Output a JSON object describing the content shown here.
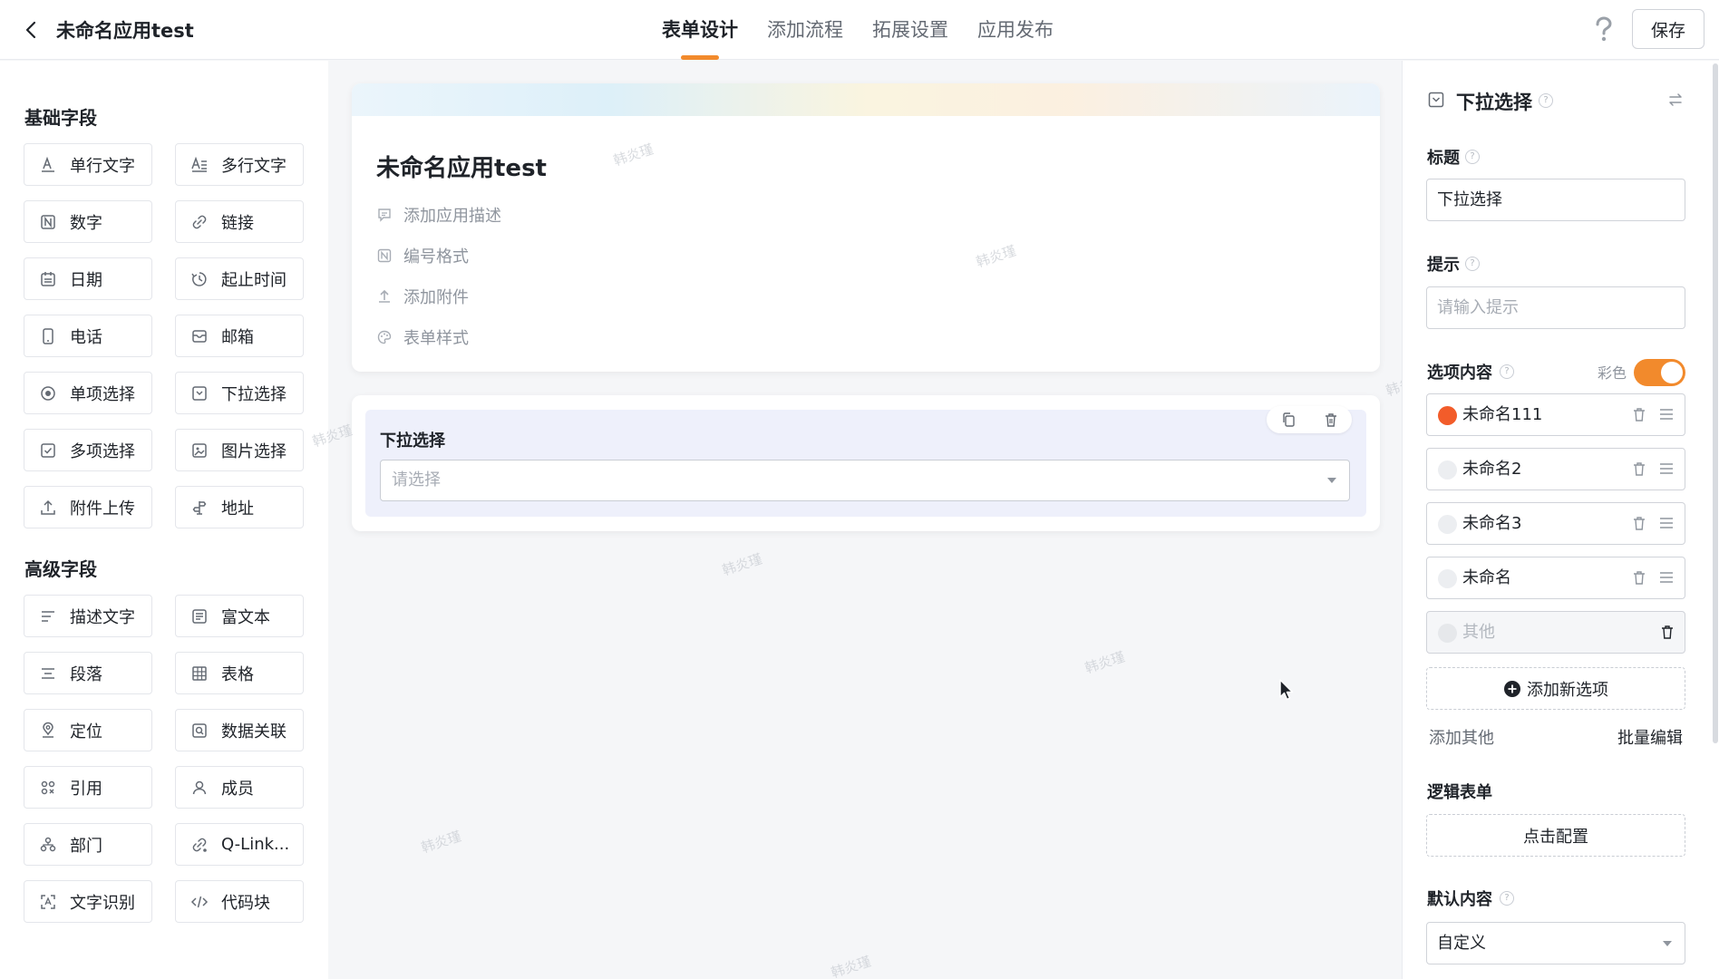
{
  "header": {
    "title": "未命名应用test",
    "tabs": [
      {
        "label": "表单设计",
        "active": true
      },
      {
        "label": "添加流程",
        "active": false
      },
      {
        "label": "拓展设置",
        "active": false
      },
      {
        "label": "应用发布",
        "active": false
      }
    ],
    "save_label": "保存"
  },
  "palette": {
    "basic_title": "基础字段",
    "basic_fields": [
      {
        "label": "单行文字",
        "icon": "single-line-text-icon"
      },
      {
        "label": "多行文字",
        "icon": "multi-line-text-icon"
      },
      {
        "label": "数字",
        "icon": "number-icon"
      },
      {
        "label": "链接",
        "icon": "link-icon"
      },
      {
        "label": "日期",
        "icon": "calendar-icon"
      },
      {
        "label": "起止时间",
        "icon": "time-range-icon"
      },
      {
        "label": "电话",
        "icon": "phone-icon"
      },
      {
        "label": "邮箱",
        "icon": "mail-icon"
      },
      {
        "label": "单项选择",
        "icon": "radio-icon"
      },
      {
        "label": "下拉选择",
        "icon": "dropdown-icon"
      },
      {
        "label": "多项选择",
        "icon": "checkbox-icon"
      },
      {
        "label": "图片选择",
        "icon": "image-icon"
      },
      {
        "label": "附件上传",
        "icon": "upload-icon"
      },
      {
        "label": "地址",
        "icon": "address-icon"
      }
    ],
    "advanced_title": "高级字段",
    "advanced_fields": [
      {
        "label": "描述文字",
        "icon": "description-icon"
      },
      {
        "label": "富文本",
        "icon": "rich-text-icon"
      },
      {
        "label": "段落",
        "icon": "paragraph-icon"
      },
      {
        "label": "表格",
        "icon": "table-icon"
      },
      {
        "label": "定位",
        "icon": "location-icon"
      },
      {
        "label": "数据关联",
        "icon": "data-link-icon"
      },
      {
        "label": "引用",
        "icon": "reference-icon"
      },
      {
        "label": "成员",
        "icon": "member-icon"
      },
      {
        "label": "部门",
        "icon": "department-icon"
      },
      {
        "label": "Q-Link...",
        "icon": "qlink-icon"
      },
      {
        "label": "文字识别",
        "icon": "ocr-icon"
      },
      {
        "label": "代码块",
        "icon": "code-icon"
      }
    ]
  },
  "canvas": {
    "form_title": "未命名应用test",
    "actions": [
      {
        "label": "添加应用描述",
        "icon": "comment-icon"
      },
      {
        "label": "编号格式",
        "icon": "number-format-icon"
      },
      {
        "label": "添加附件",
        "icon": "attachment-icon"
      },
      {
        "label": "表单样式",
        "icon": "palette-icon"
      }
    ],
    "field": {
      "label": "下拉选择",
      "placeholder": "请选择"
    },
    "watermark": "韩炎瑾"
  },
  "props": {
    "title": "下拉选择",
    "title_label": "标题",
    "title_value": "下拉选择",
    "hint_label": "提示",
    "hint_placeholder": "请输入提示",
    "options_label": "选项内容",
    "color_label": "彩色",
    "color_on": true,
    "options": [
      {
        "label": "未命名111",
        "color": "#f25c2a"
      },
      {
        "label": "未命名2",
        "color": "#eceef1"
      },
      {
        "label": "未命名3",
        "color": "#eceef1"
      },
      {
        "label": "未命名",
        "color": "#eceef1"
      }
    ],
    "other_option": "其他",
    "add_option_label": "添加新选项",
    "add_other_label": "添加其他",
    "batch_edit_label": "批量编辑",
    "logic_label": "逻辑表单",
    "logic_button": "点击配置",
    "default_label": "默认内容",
    "default_value": "自定义"
  }
}
